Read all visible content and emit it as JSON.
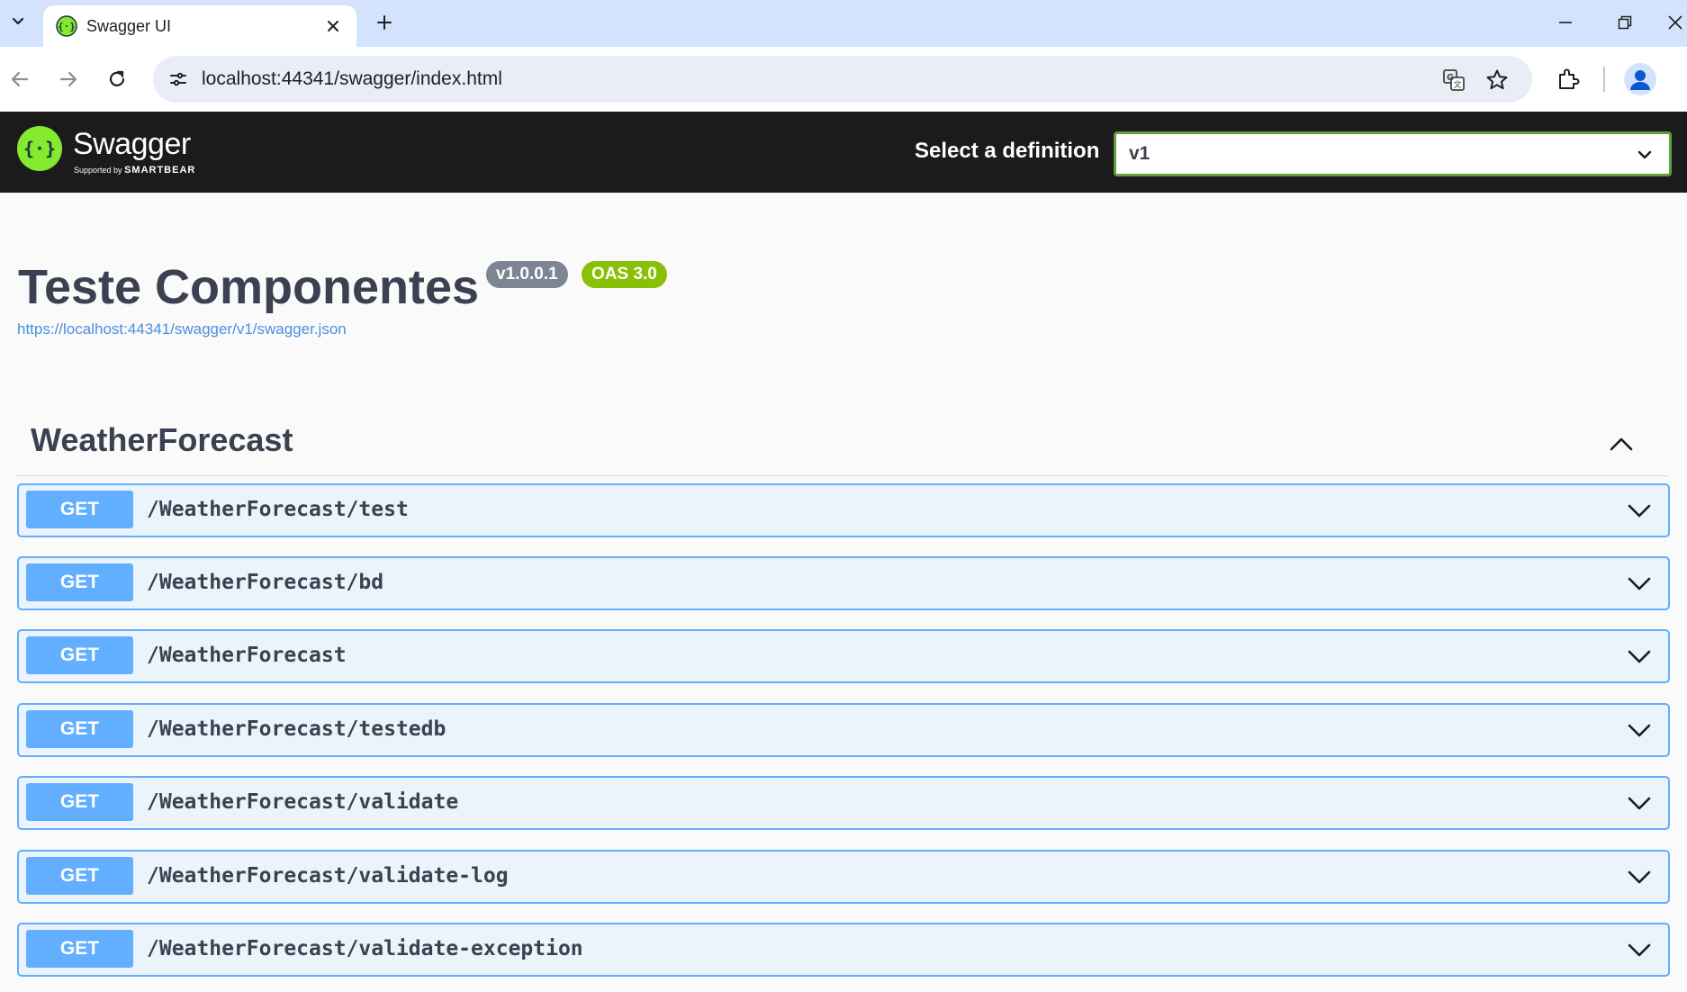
{
  "browser": {
    "tab_title": "Swagger UI",
    "url": "localhost:44341/swagger/index.html"
  },
  "topbar": {
    "logo_name": "Swagger",
    "logo_supported": "Supported by",
    "logo_brand": "SMARTBEAR",
    "definition_label": "Select a definition",
    "definition_value": "v1"
  },
  "info": {
    "title": "Teste Componentes",
    "version_badge": "v1.0.0.1",
    "oas_badge": "OAS 3.0",
    "spec_url": "https://localhost:44341/swagger/v1/swagger.json"
  },
  "tag": {
    "name": "WeatherForecast",
    "operations": [
      {
        "method": "GET",
        "path": "/WeatherForecast/test"
      },
      {
        "method": "GET",
        "path": "/WeatherForecast/bd"
      },
      {
        "method": "GET",
        "path": "/WeatherForecast"
      },
      {
        "method": "GET",
        "path": "/WeatherForecast/testedb"
      },
      {
        "method": "GET",
        "path": "/WeatherForecast/validate"
      },
      {
        "method": "GET",
        "path": "/WeatherForecast/validate-log"
      },
      {
        "method": "GET",
        "path": "/WeatherForecast/validate-exception"
      }
    ]
  },
  "colors": {
    "get_method": "#61affe",
    "get_background": "#ebf3fb",
    "topbar_background": "#1b1b1b",
    "swagger_green": "#85ea2d",
    "oas_badge": "#89bf04",
    "version_badge": "#7d8492"
  },
  "icons": [
    "tab-search-icon",
    "swagger-favicon-icon",
    "close-icon",
    "plus-icon",
    "minimize-icon",
    "restore-icon",
    "window-close-icon",
    "back-arrow-icon",
    "forward-arrow-icon",
    "reload-icon",
    "site-info-icon",
    "translate-icon",
    "star-icon",
    "extensions-icon",
    "profile-icon",
    "swagger-logo-icon",
    "chevron-down-icon",
    "chevron-up-icon"
  ]
}
